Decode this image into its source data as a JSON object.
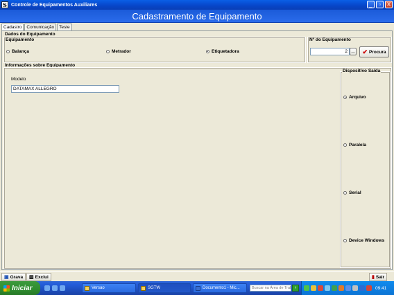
{
  "window": {
    "title": "Controle de Equipamentos Auxiliares",
    "icon": "app-letter-icon",
    "min_symbol": "_",
    "max_symbol": "▫",
    "close_symbol": "X"
  },
  "banner": {
    "title": "Cadastramento de Equipamento"
  },
  "tabs": [
    "Cadastro",
    "Comunicação",
    "Teste"
  ],
  "dados": {
    "group_title": "Dados do Equipamento",
    "equipamento_label": "Equipamento",
    "options": [
      {
        "label": "Balança",
        "checked": false
      },
      {
        "label": "Metrador",
        "checked": false
      },
      {
        "label": "Etiquetadora",
        "checked": true
      }
    ],
    "numero_label": "Nº do Equipamento",
    "numero_value": "2",
    "ellipsis": "...",
    "procura_label": "Procura"
  },
  "info": {
    "group_title": "Informações sobre Equipamento",
    "modelo_label": "Modelo",
    "modelo_value": "DATAMAX ALLEGRO"
  },
  "dispositivo": {
    "title": "Dispositivo Saída",
    "options": [
      {
        "label": "Arquivo",
        "checked": true
      },
      {
        "label": "Paralela",
        "checked": false
      },
      {
        "label": "Serial",
        "checked": false
      },
      {
        "label": "Device Windows",
        "checked": false
      }
    ]
  },
  "bottom": {
    "grava": "Grava",
    "exclui": "Exclui",
    "sair": "Sair"
  },
  "taskbar": {
    "start": "Iniciar",
    "tasks": [
      "Versao",
      "SGTW",
      "Documento1 - Mic..."
    ],
    "search_placeholder": "Buscar na Área de Trabalho",
    "go": "›",
    "clock": "09:41"
  }
}
